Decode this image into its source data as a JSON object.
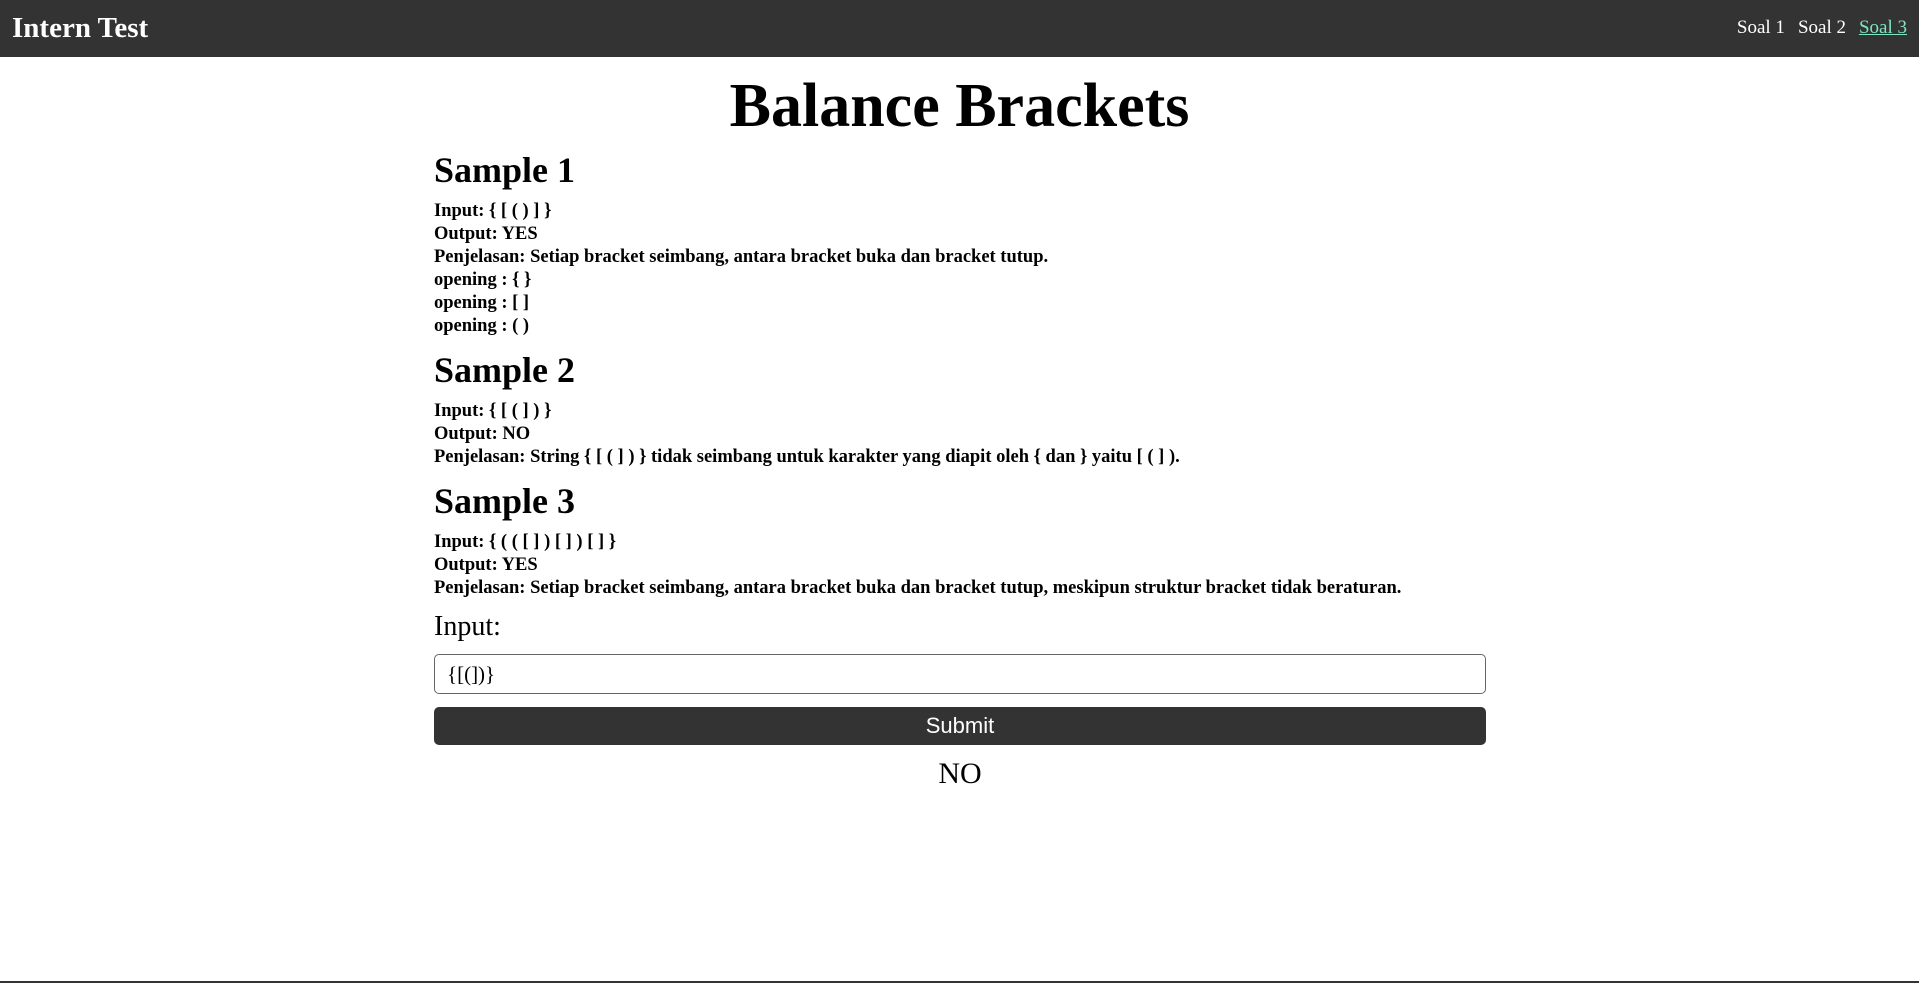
{
  "header": {
    "brand": "Intern Test",
    "nav": [
      {
        "label": "Soal 1",
        "active": false
      },
      {
        "label": "Soal 2",
        "active": false
      },
      {
        "label": "Soal 3",
        "active": true
      }
    ]
  },
  "page": {
    "title": "Balance Brackets"
  },
  "samples": [
    {
      "title": "Sample 1",
      "lines": [
        "Input: { [ ( ) ] }",
        "Output: YES",
        "Penjelasan: Setiap bracket seimbang, antara bracket buka dan bracket tutup.",
        "opening : { }",
        "opening : [ ]",
        "opening : ( )"
      ]
    },
    {
      "title": "Sample 2",
      "lines": [
        "Input: { [ ( ] ) }",
        "Output: NO",
        "Penjelasan: String { [ ( ] ) } tidak seimbang untuk karakter yang diapit oleh { dan } yaitu [ ( ] )."
      ]
    },
    {
      "title": "Sample 3",
      "lines": [
        "Input: { ( ( [ ] ) [ ] ) [ ] }",
        "Output: YES",
        "Penjelasan: Setiap bracket seimbang, antara bracket buka dan bracket tutup, meskipun struktur bracket tidak beraturan."
      ]
    }
  ],
  "form": {
    "label": "Input:",
    "value": "{[(])}",
    "submit_label": "Submit",
    "result": "NO"
  }
}
